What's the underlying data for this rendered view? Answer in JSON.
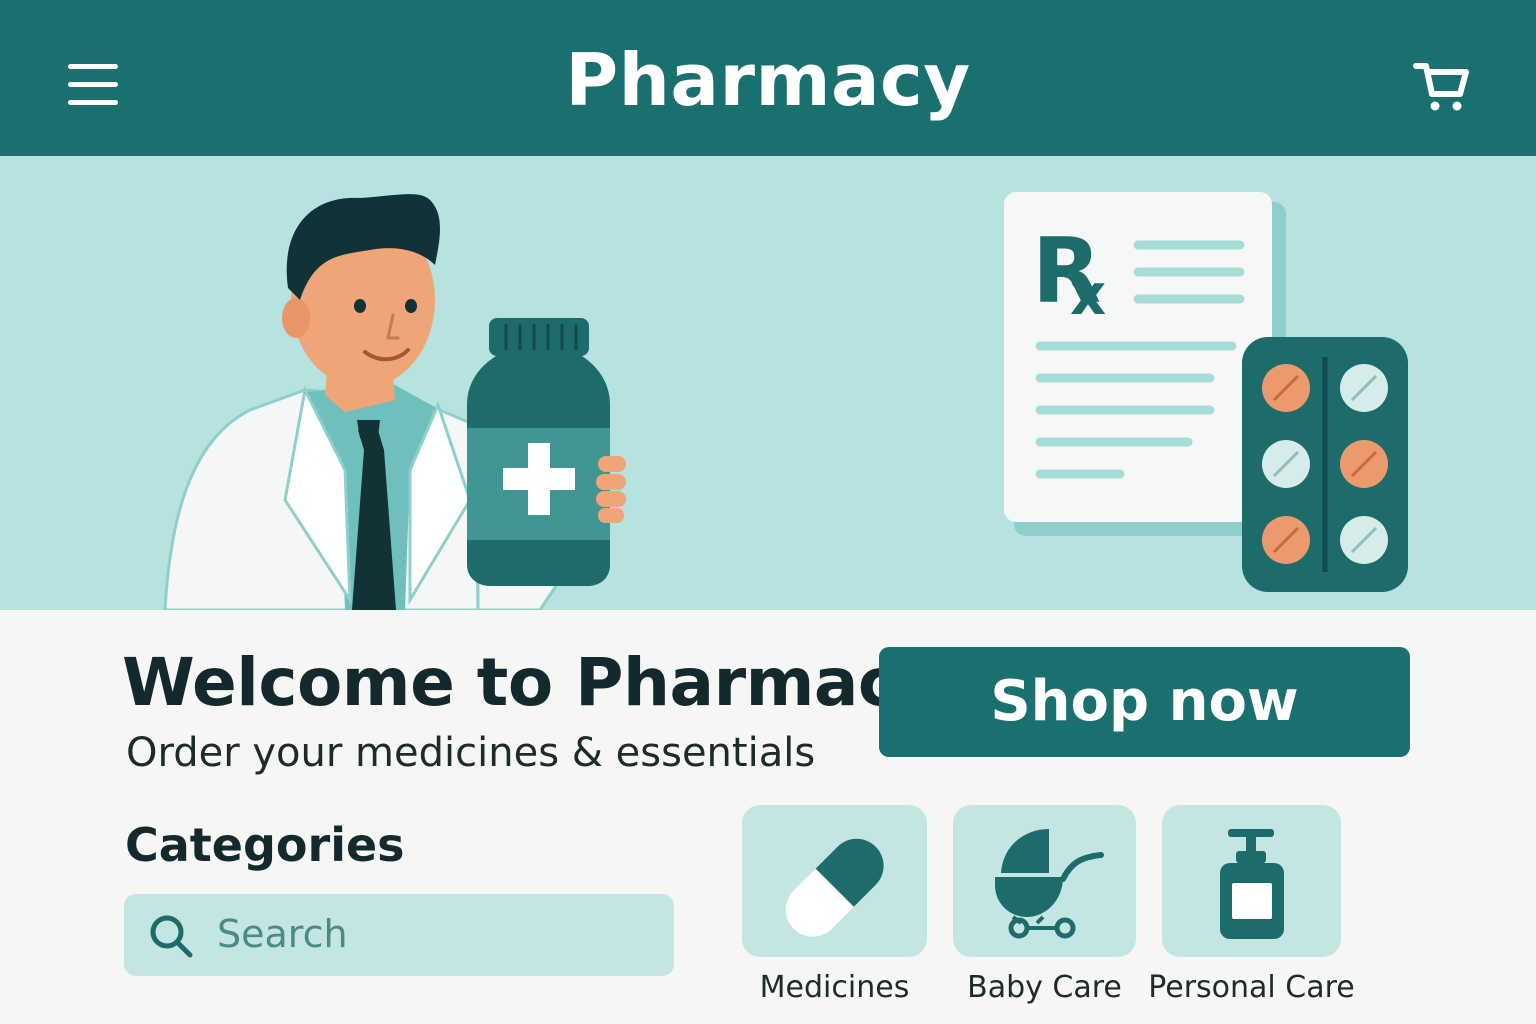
{
  "header": {
    "title": "Pharmacy",
    "menu_icon": "menu-icon",
    "cart_icon": "cart-icon"
  },
  "hero": {
    "illustration": "pharmacist-holding-medicine-bottle",
    "prescription_symbol": "Rx"
  },
  "welcome": {
    "title": "Welcome to Pharmacy",
    "subtitle": "Order your medicines & essentials"
  },
  "cta": {
    "shop_label": "Shop now"
  },
  "categories": {
    "title": "Categories",
    "search_placeholder": "Search",
    "items": [
      {
        "label": "Medicines",
        "icon": "capsule-icon"
      },
      {
        "label": "Baby Care",
        "icon": "stroller-icon"
      },
      {
        "label": "Personal Care",
        "icon": "pump-bottle-icon"
      }
    ]
  },
  "colors": {
    "primary": "#19706f",
    "hero_bg": "#b6e2df",
    "card_bg": "#c4e6e3",
    "accent_orange": "#eb9a6e",
    "text_dark": "#14292d"
  }
}
